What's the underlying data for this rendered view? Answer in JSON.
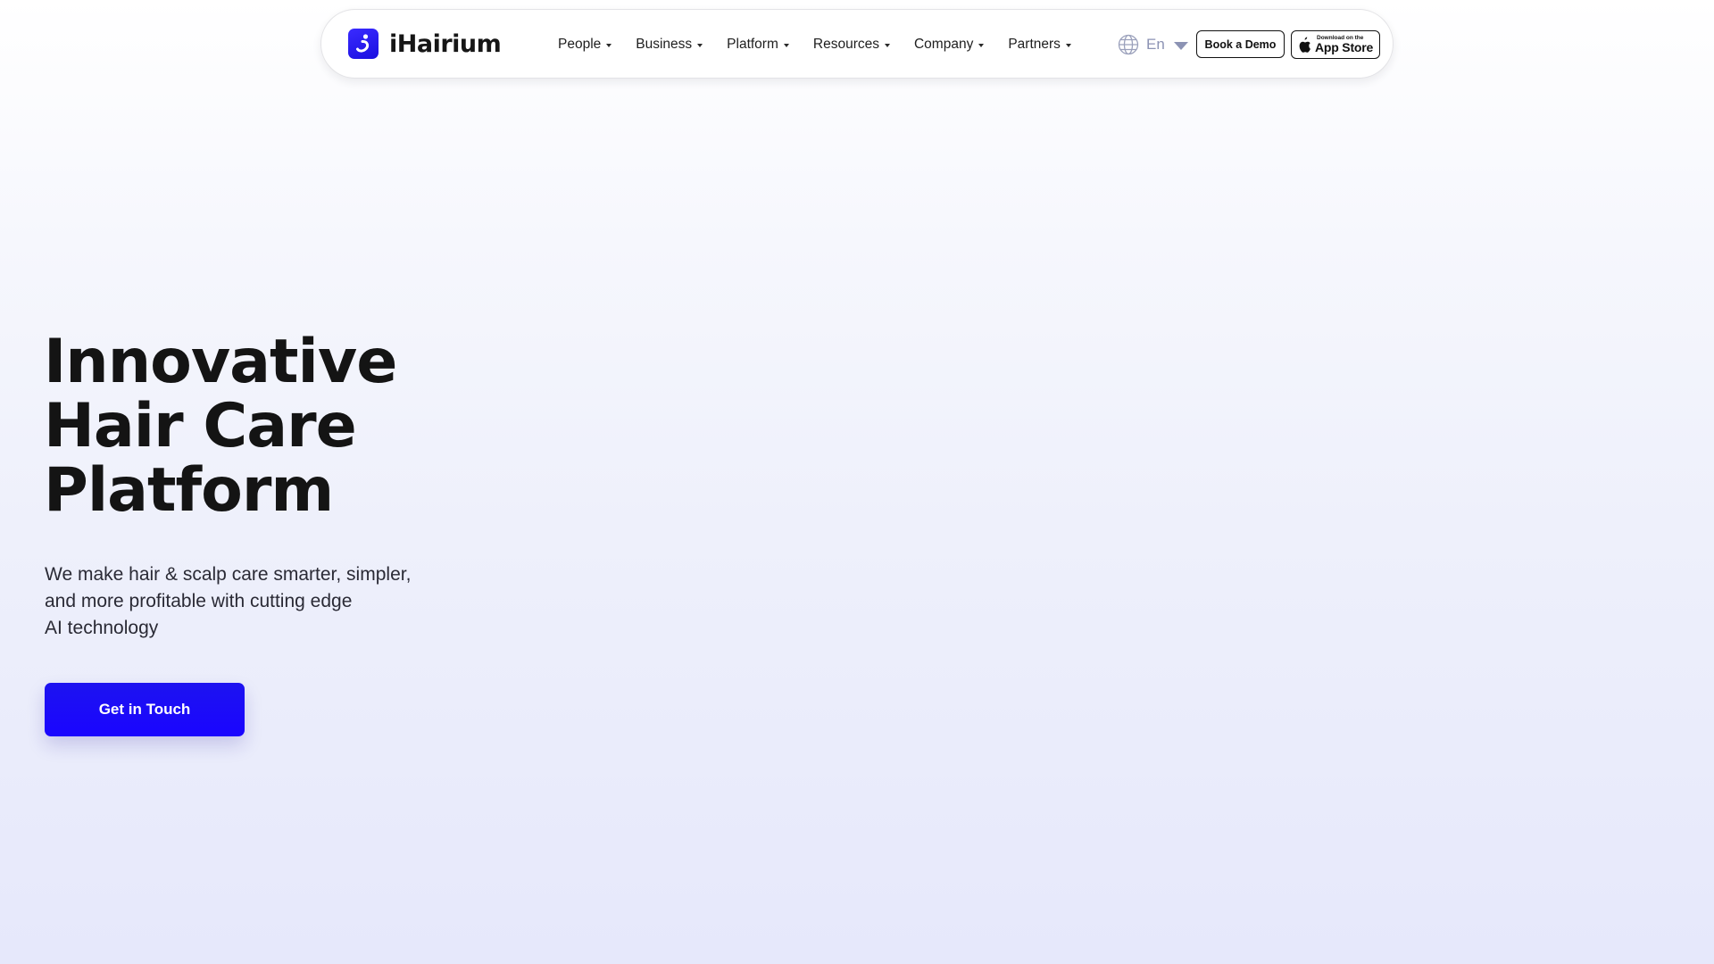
{
  "colors": {
    "brand": "#1a0fe0",
    "cta": "#1d13f0",
    "text": "#141414",
    "muted_lang": "#8c93b4"
  },
  "navbar": {
    "logo_icon": "ihairium-logo-icon",
    "logo_text": "iHairium",
    "menu": [
      {
        "label": "People"
      },
      {
        "label": "Business"
      },
      {
        "label": "Platform"
      },
      {
        "label": "Resources"
      },
      {
        "label": "Company"
      },
      {
        "label": "Partners"
      }
    ],
    "language": {
      "icon": "globe-icon",
      "label": "En"
    },
    "book_demo_label": "Book a Demo",
    "app_store": {
      "icon": "apple-icon",
      "small_label": "Download on the",
      "big_label": "App Store"
    }
  },
  "hero": {
    "title_lines": [
      "Innovative",
      "Hair Care",
      "Platform"
    ],
    "subtitle_lines": [
      "We make hair & scalp care smarter, simpler,",
      "and more profitable with cutting edge",
      "AI technology"
    ],
    "cta_label": "Get in Touch"
  }
}
